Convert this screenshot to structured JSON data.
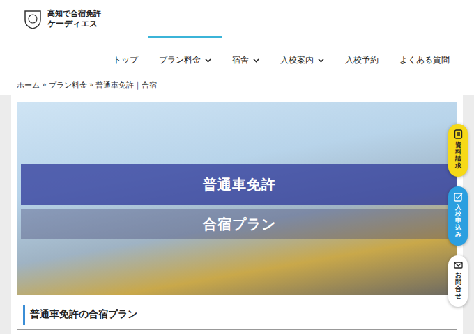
{
  "logo": {
    "line1": "高知で合宿免許",
    "line2": "ケーディエス"
  },
  "nav": [
    {
      "label": "トップ",
      "dropdown": false,
      "selected": false
    },
    {
      "label": "プラン料金",
      "dropdown": true,
      "selected": true
    },
    {
      "label": "宿舎",
      "dropdown": true,
      "selected": false
    },
    {
      "label": "入校案内",
      "dropdown": true,
      "selected": false
    },
    {
      "label": "入校予約",
      "dropdown": false,
      "selected": false
    },
    {
      "label": "よくある質問",
      "dropdown": false,
      "selected": false
    }
  ],
  "breadcrumb": {
    "items": [
      "ホーム",
      "プラン料金",
      "普通車免許｜合宿"
    ],
    "separator": "»"
  },
  "hero": {
    "title": "普通車免許",
    "subtitle": "合宿プラン"
  },
  "section_heading": "普通車免許の合宿プラン",
  "side_tabs": [
    {
      "label": "資料請求",
      "kind": "document",
      "color": "#f6d917",
      "text_color": "#222222"
    },
    {
      "label": "入校申込み",
      "kind": "form",
      "color": "#2b9fe0",
      "text_color": "#ffffff"
    },
    {
      "label": "お問合せ",
      "kind": "mail",
      "color": "#ffffff",
      "text_color": "#222222"
    }
  ]
}
